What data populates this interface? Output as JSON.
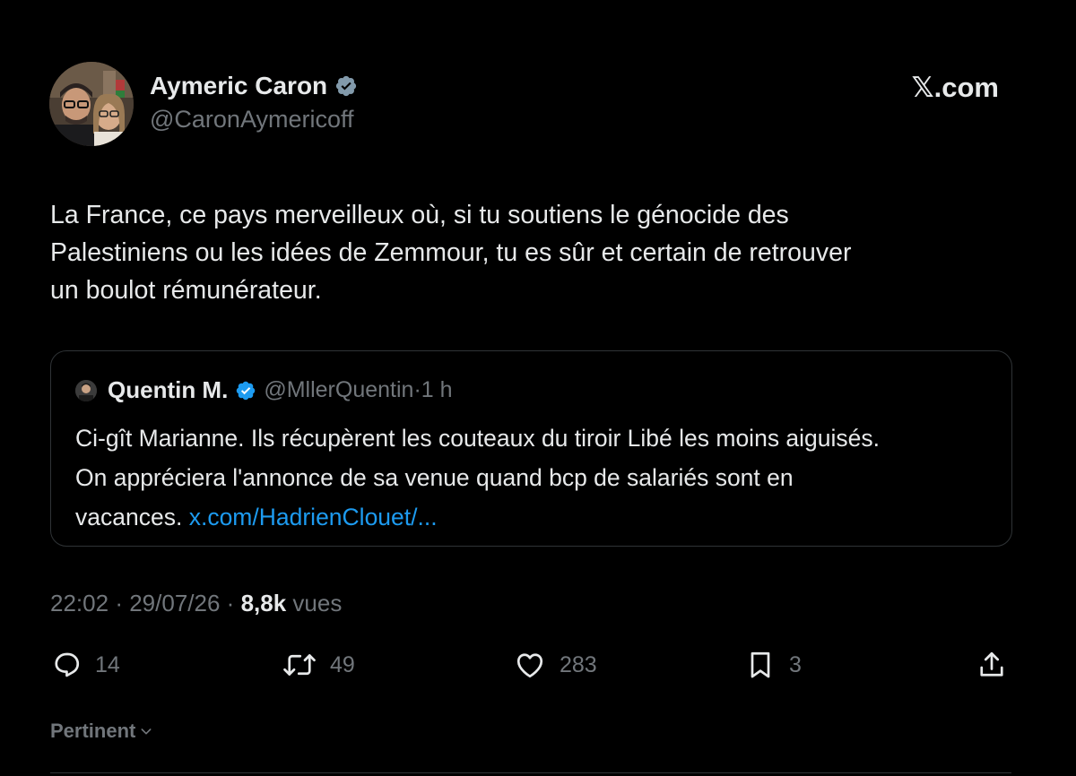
{
  "site": {
    "label": "𝕏.com"
  },
  "author": {
    "name": "Aymeric Caron",
    "handle": "@CaronAymericoff",
    "verified_color": "#829aab"
  },
  "tweet": {
    "lines": [
      "La France, ce pays merveilleux où, si tu soutiens le génocide des",
      "Palestiniens ou les idées de Zemmour, tu es sûr et certain de retrouver",
      "un boulot rémunérateur."
    ]
  },
  "quote": {
    "name": "Quentin M.",
    "handle": "@MllerQuentin",
    "separator": "·",
    "time": "1 h",
    "verified_color": "#1d9bf0",
    "lines": [
      "Ci-gît Marianne. Ils récupèrent les couteaux du tiroir Libé les moins aiguisés.",
      "On appréciera l'annonce de sa venue quand bcp de salariés sont en"
    ],
    "last_line_text": "vacances.",
    "link": "x.com/HadrienClouet/..."
  },
  "meta": {
    "time": "22:02",
    "date": "29/07/26",
    "separator": "·",
    "views": "8,8k",
    "views_label": "vues"
  },
  "actions": {
    "replies": "14",
    "reposts": "49",
    "likes": "283",
    "bookmarks": "3"
  },
  "sort": {
    "label": "Pertinent"
  },
  "colors": {
    "background": "#000000",
    "text": "#e7e9ea",
    "muted": "#71767b",
    "link": "#1d9bf0",
    "border": "#2f3336"
  }
}
